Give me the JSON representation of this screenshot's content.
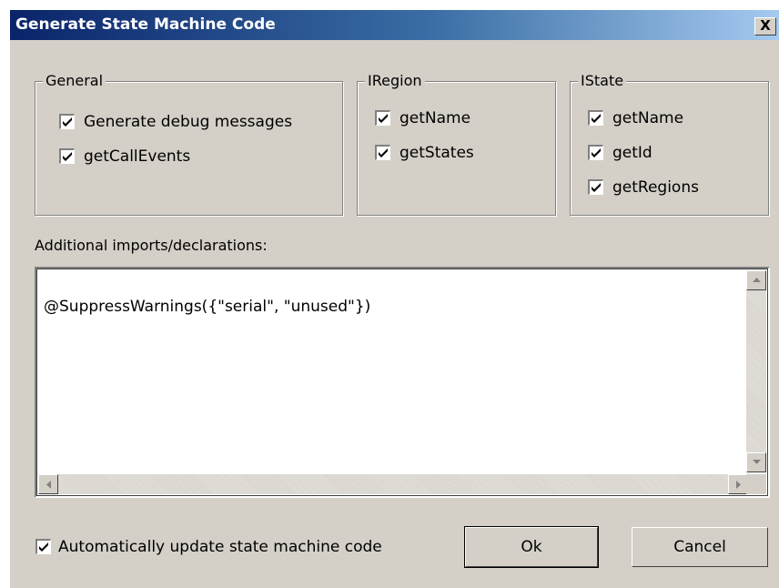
{
  "window": {
    "title": "Generate State Machine Code",
    "close_label": "X"
  },
  "groups": {
    "general": {
      "title": "General",
      "items": [
        {
          "label": "Generate debug messages",
          "checked": true
        },
        {
          "label": "getCallEvents",
          "checked": true
        }
      ]
    },
    "iregion": {
      "title": "IRegion",
      "items": [
        {
          "label": "getName",
          "checked": true
        },
        {
          "label": "getStates",
          "checked": true
        }
      ]
    },
    "istate": {
      "title": "IState",
      "items": [
        {
          "label": "getName",
          "checked": true
        },
        {
          "label": "getId",
          "checked": true
        },
        {
          "label": "getRegions",
          "checked": true
        }
      ]
    }
  },
  "imports": {
    "label": "Additional imports/declarations:",
    "value": "@SuppressWarnings({\"serial\", \"unused\"})"
  },
  "footer": {
    "auto_update_label": "Automatically update state machine code",
    "auto_update_checked": true,
    "ok_label": "Ok",
    "cancel_label": "Cancel"
  },
  "colors": {
    "titlebar_start": "#0a246a",
    "titlebar_end": "#a6caf0",
    "dialog_bg": "#d4d0c8"
  }
}
